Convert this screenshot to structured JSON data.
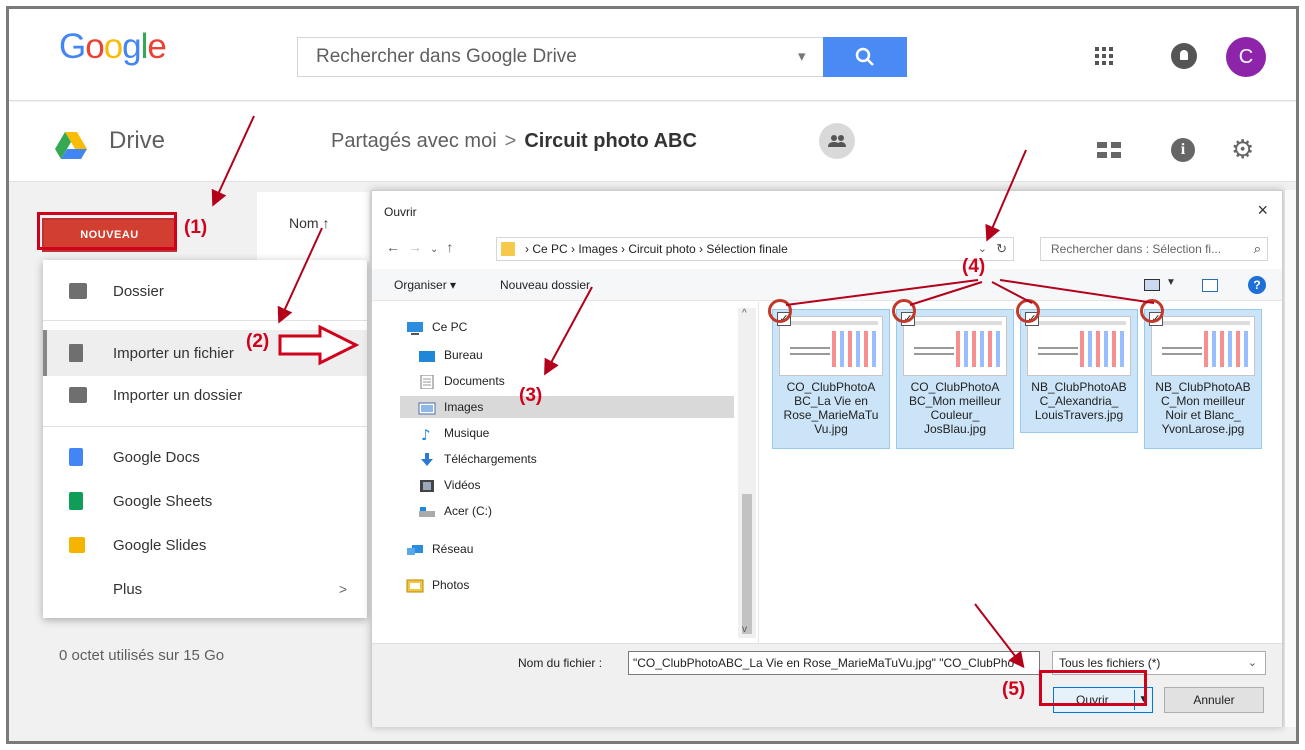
{
  "google": {
    "logo": "Google",
    "search_placeholder": "Rechercher dans Google Drive",
    "avatar_letter": "C"
  },
  "drive": {
    "title": "Drive",
    "breadcrumb_parent": "Partagés avec moi",
    "breadcrumb_sep": ">",
    "breadcrumb_current": "Circuit photo ABC"
  },
  "left": {
    "new_button": "NOUVEAU",
    "sort_column": "Nom ↑",
    "storage": "0 octet utilisés sur 15 Go"
  },
  "new_menu": {
    "items": [
      {
        "label": "Dossier",
        "icon": "folder-plus-icon"
      },
      {
        "label": "Importer un fichier",
        "icon": "file-upload-icon"
      },
      {
        "label": "Importer un dossier",
        "icon": "folder-upload-icon"
      },
      {
        "label": "Google Docs",
        "icon": "google-docs-icon"
      },
      {
        "label": "Google Sheets",
        "icon": "google-sheets-icon"
      },
      {
        "label": "Google Slides",
        "icon": "google-slides-icon"
      },
      {
        "label": "Plus",
        "icon": "chevron-right-icon"
      }
    ],
    "more_chevron": ">"
  },
  "dialog": {
    "title": "Ouvrir",
    "close": "×",
    "path": "› Ce PC  ›  Images  ›  Circuit photo  ›  Sélection finale",
    "search_placeholder": "Rechercher dans : Sélection fi...",
    "organize": "Organiser ▾",
    "new_folder": "Nouveau dossier",
    "help": "?",
    "tree": [
      {
        "label": "Ce PC",
        "icon": "pc-icon"
      },
      {
        "label": "Bureau",
        "icon": "desktop-icon"
      },
      {
        "label": "Documents",
        "icon": "documents-icon"
      },
      {
        "label": "Images",
        "icon": "images-icon"
      },
      {
        "label": "Musique",
        "icon": "music-icon"
      },
      {
        "label": "Téléchargements",
        "icon": "download-icon"
      },
      {
        "label": "Vidéos",
        "icon": "video-icon"
      },
      {
        "label": "Acer (C:)",
        "icon": "drive-icon"
      },
      {
        "label": "Réseau",
        "icon": "network-icon"
      },
      {
        "label": "Photos",
        "icon": "photos-icon"
      }
    ],
    "files": [
      {
        "name": "CO_ClubPhotoA\nBC_La Vie en\nRose_MarieMaTu\nVu.jpg"
      },
      {
        "name": "CO_ClubPhotoA\nBC_Mon meilleur\nCouleur_\nJosBlau.jpg"
      },
      {
        "name": "NB_ClubPhotoAB\nC_Alexandria_\nLouisTravers.jpg"
      },
      {
        "name": "NB_ClubPhotoAB\nC_Mon meilleur\nNoir et Blanc_\nYvonLarose.jpg"
      }
    ],
    "filename_label": "Nom du fichier :",
    "filename_value": "\"CO_ClubPhotoABC_La Vie en Rose_MarieMaTuVu.jpg\" \"CO_ClubPho",
    "filetype": "Tous les fichiers (*)",
    "open_button": "Ouvrir",
    "cancel_button": "Annuler"
  },
  "annotations": {
    "step1": "(1)",
    "step2": "(2)",
    "step3": "(3)",
    "step4": "(4)",
    "step5": "(5)",
    "color": "#d0021b"
  }
}
